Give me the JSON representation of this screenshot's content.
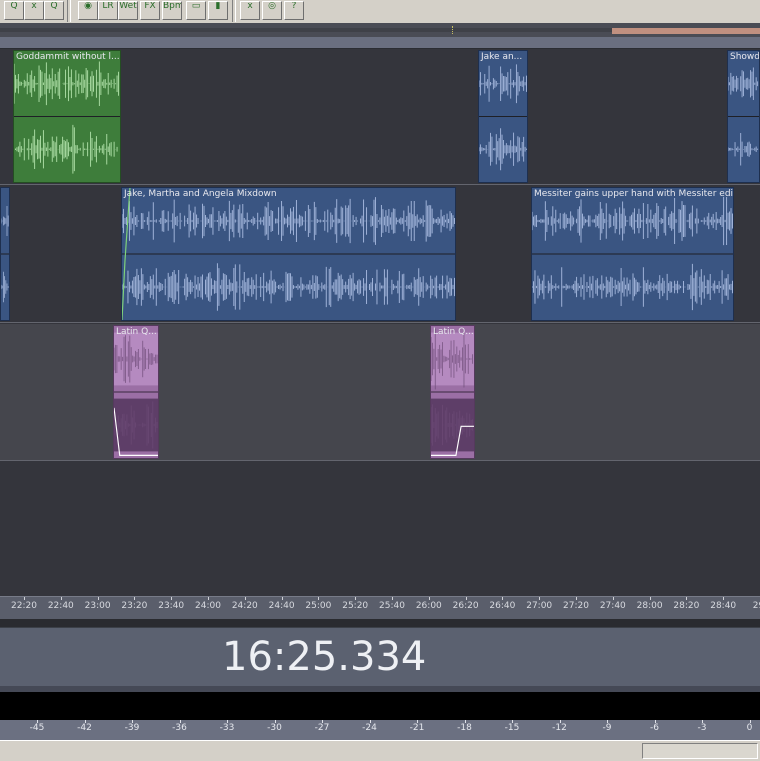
{
  "toolbar": {
    "buttons": [
      {
        "name": "zoom-icon",
        "text": "Q"
      },
      {
        "name": "sample-view-icon",
        "text": "x̄"
      },
      {
        "name": "magnify-wave-icon",
        "text": "Q"
      },
      {
        "name": "record-icon",
        "text": "◉"
      },
      {
        "name": "envelope-icon",
        "text": "LR"
      },
      {
        "name": "wet-icon",
        "text": "Wet"
      },
      {
        "name": "fx-icon",
        "text": "FX"
      },
      {
        "name": "bpm-icon",
        "text": "Bpm"
      },
      {
        "name": "clip-icon",
        "text": "▭"
      },
      {
        "name": "meter-icon",
        "text": "▮"
      },
      {
        "name": "record-mute-icon",
        "text": "x̄"
      },
      {
        "name": "loop-icon",
        "text": "◎"
      },
      {
        "name": "help-icon",
        "text": "?"
      }
    ]
  },
  "tracks": [
    {
      "clips": [
        {
          "name": "Goddammit without l...",
          "color": "green",
          "start": 13,
          "end": 121
        },
        {
          "name": "Jake an...",
          "color": "blue",
          "start": 478,
          "end": 528
        },
        {
          "name": "Showd",
          "color": "blue",
          "start": 727,
          "end": 760
        }
      ]
    },
    {
      "clips": [
        {
          "name": "",
          "color": "blue",
          "start": 0,
          "end": 10
        },
        {
          "name": "Jake, Martha and Angela Mixdown",
          "color": "blue",
          "start": 121,
          "end": 456
        },
        {
          "name": "Messiter gains upper hand with Messiter edit",
          "color": "blue",
          "start": 531,
          "end": 734
        }
      ]
    },
    {
      "clips": [
        {
          "name": "Latin Q...",
          "color": "purple",
          "start": 113,
          "end": 159
        },
        {
          "name": "Latin Q...",
          "color": "purple",
          "start": 430,
          "end": 475
        }
      ]
    }
  ],
  "timeline": {
    "ticks": [
      "22:20",
      "22:40",
      "23:00",
      "23:20",
      "23:40",
      "24:00",
      "24:20",
      "24:40",
      "25:00",
      "25:20",
      "25:40",
      "26:00",
      "26:20",
      "26:40",
      "27:00",
      "27:20",
      "27:40",
      "28:00",
      "28:20",
      "28:40",
      "29:"
    ]
  },
  "time_display": "16:25.334",
  "meter": {
    "ticks": [
      "-45",
      "-42",
      "-39",
      "-36",
      "-33",
      "-30",
      "-27",
      "-24",
      "-21",
      "-18",
      "-15",
      "-12",
      "-9",
      "-6",
      "-3",
      "0"
    ]
  },
  "colors": {
    "green_clip": "#3e7d3b",
    "blue_clip": "#3a5582",
    "purple_clip": "#9b6fa5",
    "background": "#34353c"
  }
}
